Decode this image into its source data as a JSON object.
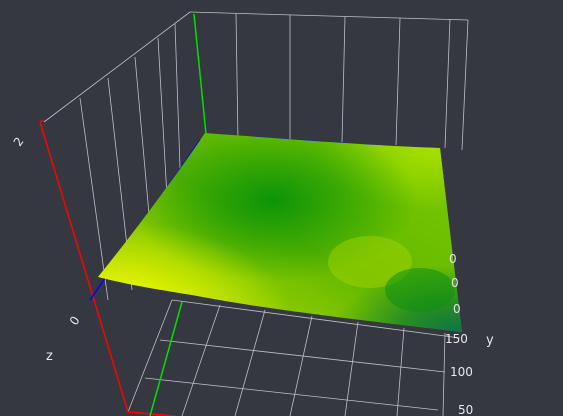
{
  "scene": {
    "background": "#353841",
    "gridline_color": "#d8d8d8",
    "axis_colors": {
      "x": "#0000ff",
      "y": "#00e000",
      "z": "#ff0000"
    }
  },
  "axes": {
    "z": {
      "title": "z",
      "ticks": [
        "2",
        "0"
      ]
    },
    "y": {
      "title": "y",
      "ticks": [
        "150",
        "100",
        "50"
      ]
    },
    "x": {
      "partial_ticks": [
        "0",
        "0",
        "0"
      ]
    }
  },
  "surface": {
    "colorscale": [
      "#ffff00",
      "#7fd000",
      "#0c9a08",
      "#0a7048"
    ]
  }
}
